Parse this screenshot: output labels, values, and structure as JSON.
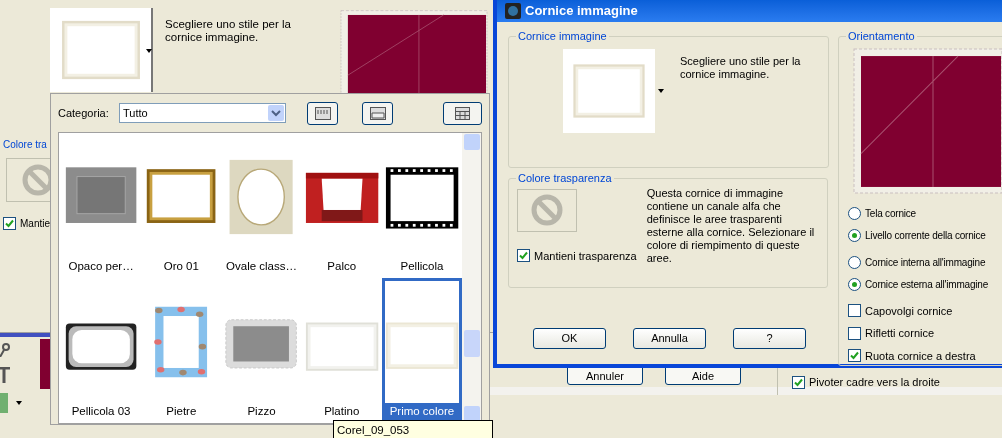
{
  "background_dialog": {
    "description": "Scegliere uno stile per la cornice immagine.",
    "transparency_label": "Colore tra",
    "keep_transparency": {
      "label": "Mantie",
      "checked": true
    }
  },
  "french_dialog": {
    "buttons": [
      "Annuler",
      "Aide"
    ],
    "rotate": {
      "label": "Pivoter cadre vers la droite",
      "checked": true
    }
  },
  "dialog": {
    "title": "Cornice immagine",
    "frame_group": {
      "title": "Cornice immagine",
      "description": "Scegliere uno stile per la cornice immagine."
    },
    "transparency_group": {
      "title": "Colore trasparenza",
      "description": "Questa cornice di immagine contiene un canale alfa che definisce le aree trasparenti esterne alla cornice. Selezionare il colore di riempimento di queste aree.",
      "keep": {
        "label": "Mantieni trasparenza",
        "checked": true
      }
    },
    "buttons": [
      "OK",
      "Annulla",
      "?"
    ],
    "orientation_group": {
      "title": "Orientamento",
      "target_options": [
        {
          "label": "Tela cornice",
          "selected": false
        },
        {
          "label": "Livello corrente della cornice",
          "selected": true
        }
      ],
      "placement_options": [
        {
          "label": "Cornice interna all'immagine",
          "selected": false
        },
        {
          "label": "Cornice esterna all'immagine",
          "selected": true
        }
      ],
      "checkboxes": [
        {
          "label": "Capovolgi cornice",
          "checked": false
        },
        {
          "label": "Rifletti cornice",
          "checked": false
        },
        {
          "label": "Ruota cornice a destra",
          "checked": true
        }
      ]
    }
  },
  "frame_picker": {
    "category_label": "Categoria:",
    "category_value": "Tutto",
    "frames": [
      {
        "label": "Opaco per…",
        "kind": "matte",
        "selected": false
      },
      {
        "label": "Oro 01",
        "kind": "gold",
        "selected": false
      },
      {
        "label": "Ovale class…",
        "kind": "oval",
        "selected": false
      },
      {
        "label": "Palco",
        "kind": "curtain",
        "selected": false
      },
      {
        "label": "Pellicola",
        "kind": "film",
        "selected": false
      },
      {
        "label": "Pellicola 03",
        "kind": "blur",
        "selected": false
      },
      {
        "label": "Pietre",
        "kind": "stones",
        "selected": false
      },
      {
        "label": "Pizzo",
        "kind": "lace",
        "selected": false
      },
      {
        "label": "Platino",
        "kind": "platinum",
        "selected": false
      },
      {
        "label": "Primo colore",
        "kind": "cream",
        "selected": true
      }
    ]
  },
  "tooltip": "Corel_09_053"
}
